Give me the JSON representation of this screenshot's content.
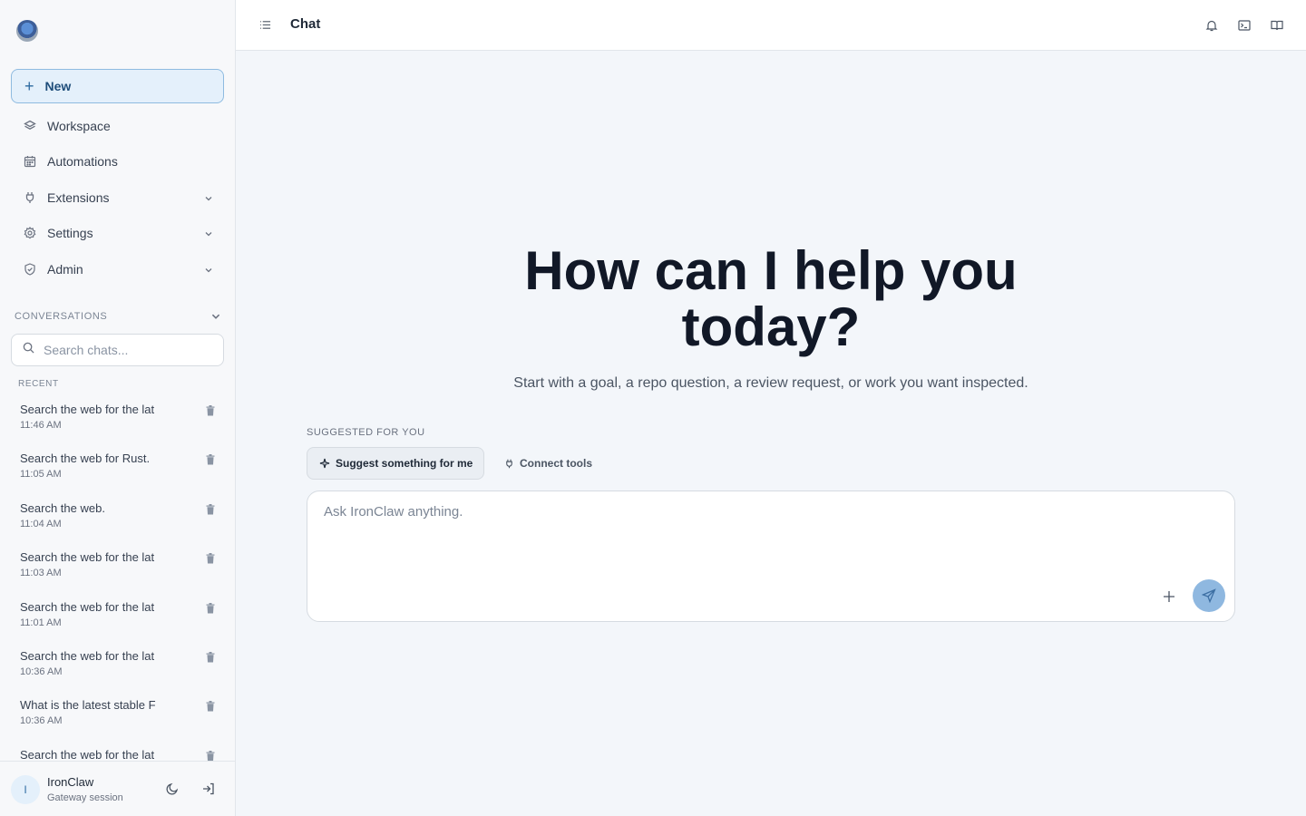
{
  "sidebar": {
    "new_label": "New",
    "nav": [
      {
        "label": "Workspace",
        "icon": "layers-icon"
      },
      {
        "label": "Automations",
        "icon": "calendar-icon"
      },
      {
        "label": "Extensions",
        "icon": "plug-icon"
      },
      {
        "label": "Settings",
        "icon": "gear-icon"
      },
      {
        "label": "Admin",
        "icon": "shield-icon"
      }
    ],
    "conversations_label": "CONVERSATIONS",
    "search_placeholder": "Search chats...",
    "recent_label": "RECENT",
    "conversations": [
      {
        "title": "Search the web for the lat",
        "time": "11:46 AM"
      },
      {
        "title": "Search the web for Rust.",
        "time": "11:05 AM"
      },
      {
        "title": "Search the web.",
        "time": "11:04 AM"
      },
      {
        "title": "Search the web for the lat",
        "time": "11:03 AM"
      },
      {
        "title": "Search the web for the lat",
        "time": "11:01 AM"
      },
      {
        "title": "Search the web for the lat",
        "time": "10:36 AM"
      },
      {
        "title": "What is the latest stable F",
        "time": "10:36 AM"
      },
      {
        "title": "Search the web for the lat",
        "time": ""
      }
    ],
    "user": {
      "initial": "I",
      "name": "IronClaw",
      "subtitle": "Gateway session"
    }
  },
  "header": {
    "title": "Chat"
  },
  "main": {
    "hero_line1": "How can I help you",
    "hero_line2": "today?",
    "subtitle": "Start with a goal, a repo question, a review request, or work you want inspected.",
    "suggested_label": "SUGGESTED FOR YOU",
    "chip_suggest": "Suggest something for me",
    "chip_connect": "Connect tools",
    "composer_placeholder": "Ask IronClaw anything."
  },
  "colors": {
    "accent": "#8fb8e0",
    "accent_border": "#8fbbe0",
    "background": "#f3f6fa"
  }
}
